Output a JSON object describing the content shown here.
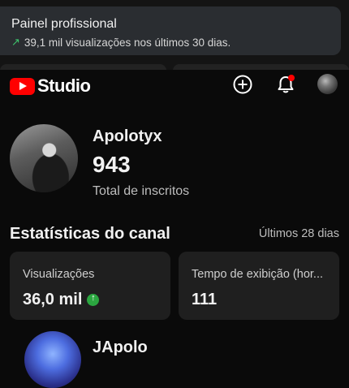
{
  "notification": {
    "title": "Painel profissional",
    "subtitle": "39,1 mil visualizações nos últimos 30 dias.",
    "trend_icon": "trending-up-arrow-icon",
    "trend_color": "#3ec46d"
  },
  "header": {
    "app_name": "Studio",
    "brand_color": "#ff0000",
    "icons": [
      "create-plus-icon",
      "notifications-bell-icon",
      "account-avatar"
    ],
    "notification_dot_color": "#ff0000"
  },
  "channel": {
    "name": "Apolotyx",
    "subscribers": "943",
    "subscribers_label": "Total de inscritos"
  },
  "stats": {
    "title": "Estatísticas do canal",
    "period": "Últimos 28 dias",
    "cards": [
      {
        "label": "Visualizações",
        "value": "36,0 mil",
        "trend": "up",
        "trend_color": "#2ba640"
      },
      {
        "label": "Tempo de exibição (hor...",
        "value": "111"
      }
    ]
  },
  "next_item": {
    "name": "JApolo"
  }
}
